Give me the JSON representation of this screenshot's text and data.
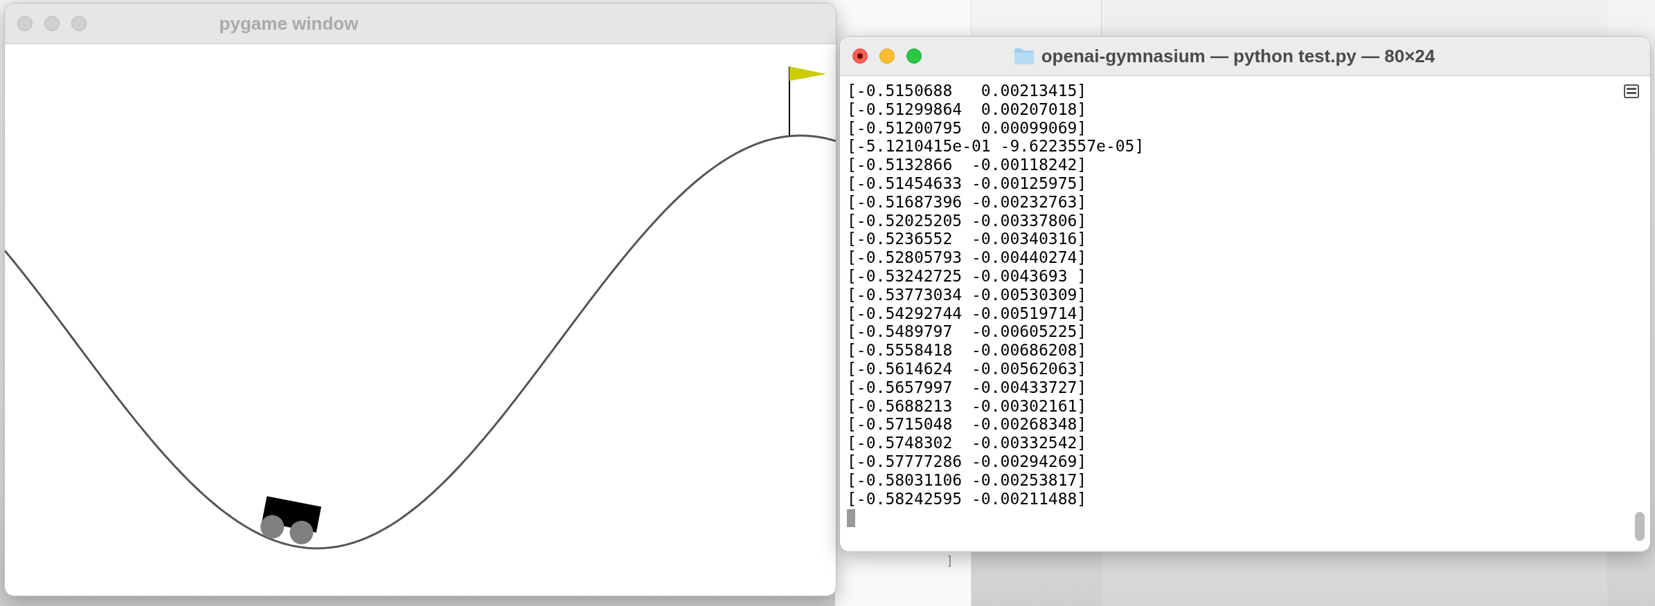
{
  "background_editor": {
    "text": "]"
  },
  "pygame_window": {
    "title": "pygame window",
    "active": false
  },
  "terminal_window": {
    "title": "openai-gymnasium — python test.py — 80×24",
    "active": true,
    "lines": [
      "[-0.5150688   0.00213415]",
      "[-0.51299864  0.00207018]",
      "[-0.51200795  0.00099069]",
      "[-5.1210415e-01 -9.6223557e-05]",
      "[-0.5132866  -0.00118242]",
      "[-0.51454633 -0.00125975]",
      "[-0.51687396 -0.00232763]",
      "[-0.52025205 -0.00337806]",
      "[-0.5236552  -0.00340316]",
      "[-0.52805793 -0.00440274]",
      "[-0.53242725 -0.0043693 ]",
      "[-0.53773034 -0.00530309]",
      "[-0.54292744 -0.00519714]",
      "[-0.5489797  -0.00605225]",
      "[-0.5558418  -0.00686208]",
      "[-0.5614624  -0.00562063]",
      "[-0.5657997  -0.00433727]",
      "[-0.5688213  -0.00302161]",
      "[-0.5715048  -0.00268348]",
      "[-0.5748302  -0.00332542]",
      "[-0.57777286 -0.00294269]",
      "[-0.58031106 -0.00253817]",
      "[-0.58242595 -0.00211488]"
    ]
  }
}
